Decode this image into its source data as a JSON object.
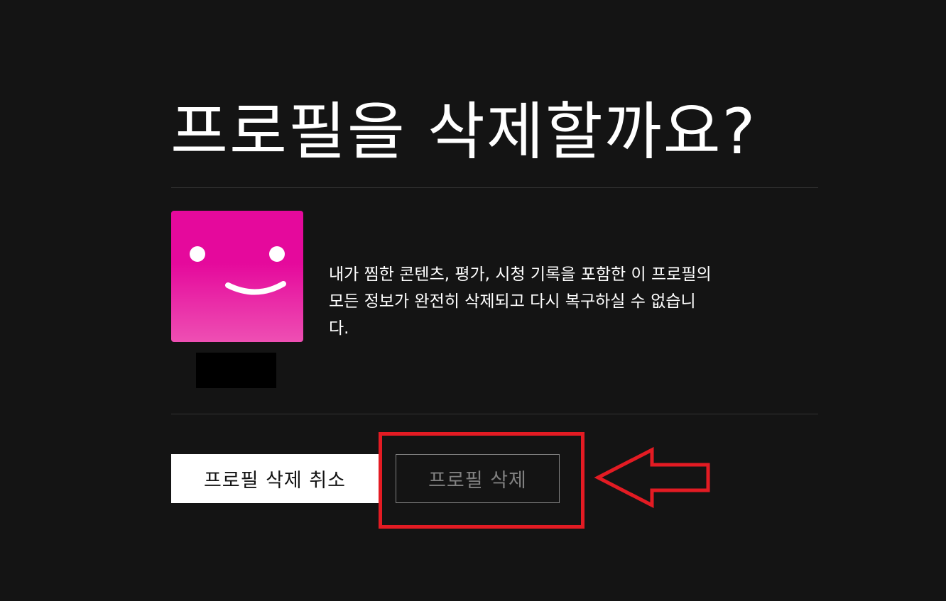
{
  "dialog": {
    "title": "프로필을 삭제할까요?",
    "description": "내가 찜한 콘텐츠, 평가, 시청 기록을 포함한 이 프로필의 모든 정보가 완전히 삭제되고 다시 복구하실 수 없습니다.",
    "avatar_icon": "smiley-face-icon",
    "avatar_color": "#e5099c"
  },
  "actions": {
    "cancel_label": "프로필 삭제 취소",
    "delete_label": "프로필 삭제"
  },
  "annotation": {
    "highlight_color": "#e31b23"
  }
}
